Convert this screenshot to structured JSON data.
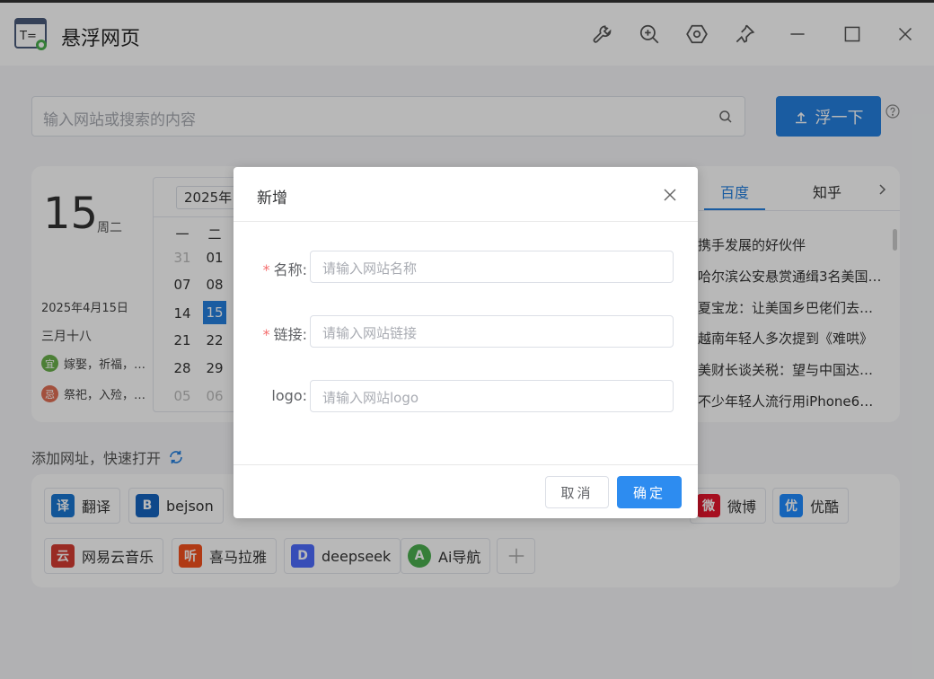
{
  "window": {
    "title": "悬浮网页"
  },
  "search": {
    "placeholder": "输入网站或搜索的内容",
    "button_label": "浮一下"
  },
  "calendar": {
    "day": "15",
    "weekday": "周二",
    "date_full": "2025年4月15日",
    "lunar": "三月十八",
    "yi_badge": "宜",
    "yi_text": "嫁娶，祈福，…",
    "ji_badge": "忌",
    "ji_text": "祭祀，入殓，…",
    "year_select": "2025年",
    "week_headers": [
      "一",
      "二"
    ],
    "rows": [
      [
        "31",
        "01"
      ],
      [
        "07",
        "08"
      ],
      [
        "14",
        "15"
      ],
      [
        "21",
        "22"
      ],
      [
        "28",
        "29"
      ],
      [
        "05",
        "06"
      ]
    ]
  },
  "news": {
    "tabs": [
      "百度",
      "知乎"
    ],
    "items": [
      "携手发展的好伙伴",
      "哈尔滨公安悬赏通缉3名美国…",
      "夏宝龙：让美国乡巴佬们去…",
      "越南年轻人多次提到《难哄》",
      "美财长谈关税：望与中国达…",
      "不少年轻人流行用iPhone6拍照"
    ]
  },
  "links": {
    "section_title": "添加网址，快速打开",
    "items": [
      {
        "label": "翻译",
        "icon_text": "译",
        "color": "#1976d2"
      },
      {
        "label": "bejson",
        "icon_text": "B",
        "color": "#1565c0"
      },
      {
        "label": "微博",
        "icon_text": "微",
        "color": "#e6162d"
      },
      {
        "label": "优酷",
        "icon_text": "优",
        "color": "#1f8bff"
      },
      {
        "label": "网易云音乐",
        "icon_text": "云",
        "color": "#d43c33"
      },
      {
        "label": "喜马拉雅",
        "icon_text": "听",
        "color": "#f4511e"
      },
      {
        "label": "deepseek",
        "icon_text": "D",
        "color": "#4d6bfe"
      },
      {
        "label": "Ai导航",
        "icon_text": "A",
        "color": "#4caf50"
      }
    ]
  },
  "dialog": {
    "title": "新增",
    "name_label": "名称:",
    "name_placeholder": "请输入网站名称",
    "link_label": "链接:",
    "link_placeholder": "请输入网站链接",
    "logo_label": "logo:",
    "logo_placeholder": "请输入网站logo",
    "required_mark": "*",
    "cancel": "取消",
    "ok": "确定"
  },
  "colors": {
    "primary": "#2580e0",
    "danger": "#f56c6c",
    "yi": "#6ab04c",
    "ji": "#e17055"
  }
}
